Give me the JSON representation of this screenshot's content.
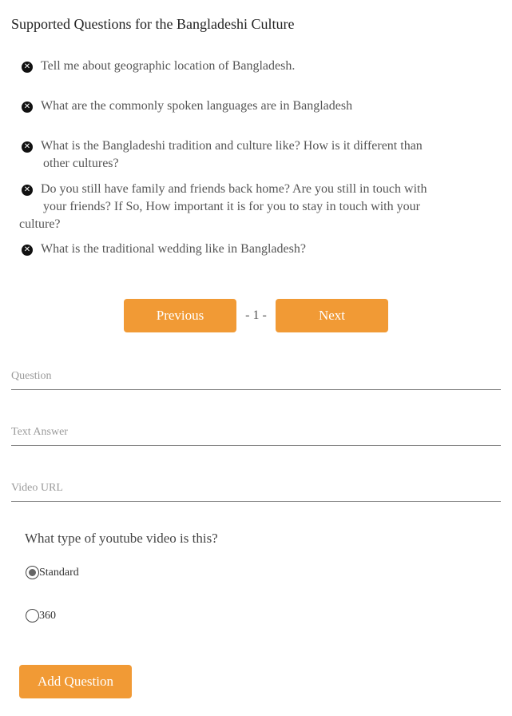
{
  "title": "Supported Questions for the Bangladeshi Culture",
  "questions": [
    {
      "text": "Tell me about geographic location of Bangladesh."
    },
    {
      "text": "What are the commonly spoken languages are in Bangladesh"
    },
    {
      "text_line1": "What is the Bangladeshi tradition and culture like? How is it different than",
      "text_line2": "other cultures?"
    },
    {
      "text_line1": "Do you still have family and friends back home? Are you still in touch with",
      "text_line2": "your friends? If So, How important it is for you to stay in touch with your",
      "text_line3": "culture?"
    },
    {
      "text": "What is the traditional wedding like in Bangladesh?"
    }
  ],
  "delete_icon": "times-circle-icon",
  "pager": {
    "previous_label": "Previous",
    "page_indicator": "- 1 -",
    "next_label": "Next"
  },
  "form": {
    "question_placeholder": "Question",
    "answer_placeholder": "Text Answer",
    "video_placeholder": "Video URL",
    "question_value": "",
    "answer_value": "",
    "video_value": ""
  },
  "video_type": {
    "label": "What type of youtube video is this?",
    "options": [
      {
        "label": "Standard",
        "selected": true
      },
      {
        "label": "360",
        "selected": false
      }
    ]
  },
  "add_button_label": "Add Question",
  "colors": {
    "accent": "#f19a35"
  }
}
